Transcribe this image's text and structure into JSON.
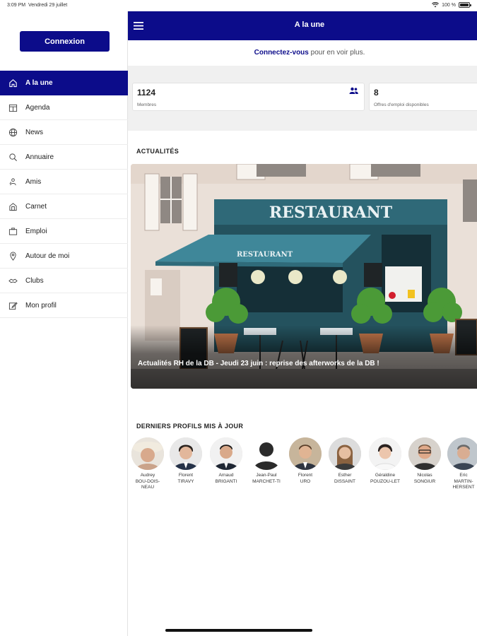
{
  "status_bar": {
    "time": "3:09 PM",
    "date": "Vendredi 29 juillet",
    "battery": "100 %"
  },
  "sidebar": {
    "login_label": "Connexion",
    "items": [
      {
        "label": "A la une",
        "icon": "home-icon",
        "active": true
      },
      {
        "label": "Agenda",
        "icon": "calendar-icon",
        "active": false
      },
      {
        "label": "News",
        "icon": "globe-icon",
        "active": false
      },
      {
        "label": "Annuaire",
        "icon": "search-icon",
        "active": false
      },
      {
        "label": "Amis",
        "icon": "friends-icon",
        "active": false
      },
      {
        "label": "Carnet",
        "icon": "notebook-icon",
        "active": false
      },
      {
        "label": "Emploi",
        "icon": "briefcase-icon",
        "active": false
      },
      {
        "label": "Autour de moi",
        "icon": "location-pin-icon",
        "active": false
      },
      {
        "label": "Clubs",
        "icon": "handshake-icon",
        "active": false
      },
      {
        "label": "Mon profil",
        "icon": "edit-profile-icon",
        "active": false
      }
    ]
  },
  "appbar": {
    "title": "A la une"
  },
  "notice": {
    "link": "Connectez-vous",
    "text": " pour en voir plus."
  },
  "stats": {
    "members": {
      "value": "1124",
      "label": "Membres"
    },
    "jobs": {
      "value": "8",
      "label": "Offres d'emploi disponibles"
    }
  },
  "news": {
    "section_title": "ACTUALITÉS",
    "caption": "Actualités RH de la DB - Jeudi 23 juin : reprise des afterworks de la DB !",
    "sign_text": "RESTAURANT",
    "awning_text": "RESTAURANT"
  },
  "profiles": {
    "section_title": "DERNIERS PROFILS MIS À JOUR",
    "items": [
      {
        "first": "Audrey",
        "last": "BOU-DOIS-NEAU"
      },
      {
        "first": "Florent",
        "last": "TIRAVY"
      },
      {
        "first": "Arnaud",
        "last": "BRIGANTI"
      },
      {
        "first": "Jean-Paul",
        "last": "MARCHET-TI"
      },
      {
        "first": "Florent",
        "last": "URO"
      },
      {
        "first": "Esther",
        "last": "DISSAINT"
      },
      {
        "first": "Géraldine",
        "last": "POUZOU-LET"
      },
      {
        "first": "Nicolas",
        "last": "SONGIUR"
      },
      {
        "first": "Eric",
        "last": "MARTIN-HERSENT"
      }
    ]
  },
  "colors": {
    "brand": "#0c0c8a",
    "background_gray": "#f0f0f0"
  }
}
